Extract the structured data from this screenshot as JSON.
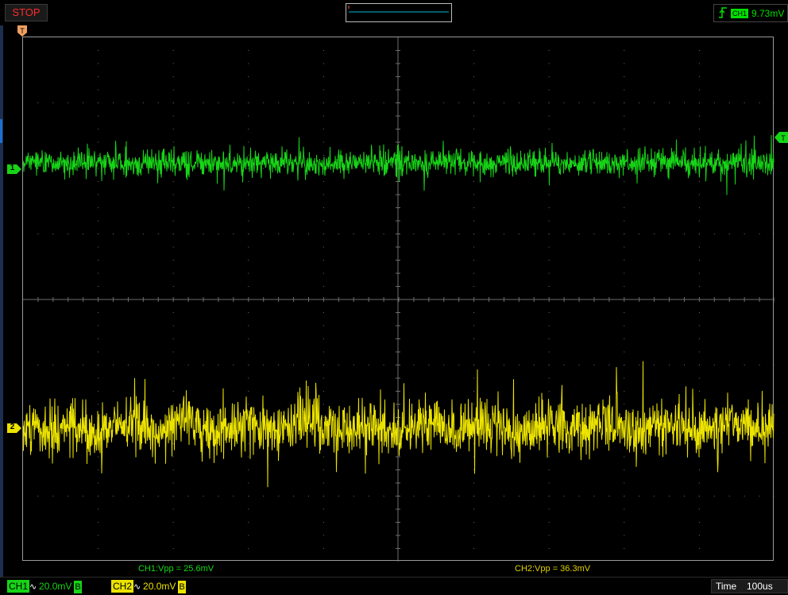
{
  "app": {
    "run_state": "STOP",
    "trigger": {
      "channel": "CH1",
      "level": "9.73mV",
      "edge": "rising"
    },
    "trigger_position_marker": "T",
    "trigger_level_marker": "T"
  },
  "channels": [
    {
      "id": "1",
      "label": "CH1",
      "coupling": "AC",
      "volts_per_div": "20.0mV",
      "bandwidth_flag": "B",
      "color": "#17d417",
      "measurement": "CH1:Vpp = 25.6mV"
    },
    {
      "id": "2",
      "label": "CH2",
      "coupling": "AC",
      "volts_per_div": "20.0mV",
      "bandwidth_flag": "B",
      "color": "#ece300",
      "measurement": "CH2:Vpp = 36.3mV"
    }
  ],
  "timebase": {
    "label": "Time",
    "value": "100us"
  },
  "colors": {
    "ch1": "#17d417",
    "ch2": "#ece300",
    "stop": "#ff2a2a",
    "grid": "#6e6e6e",
    "screen_border": "#9a9a9a"
  }
}
